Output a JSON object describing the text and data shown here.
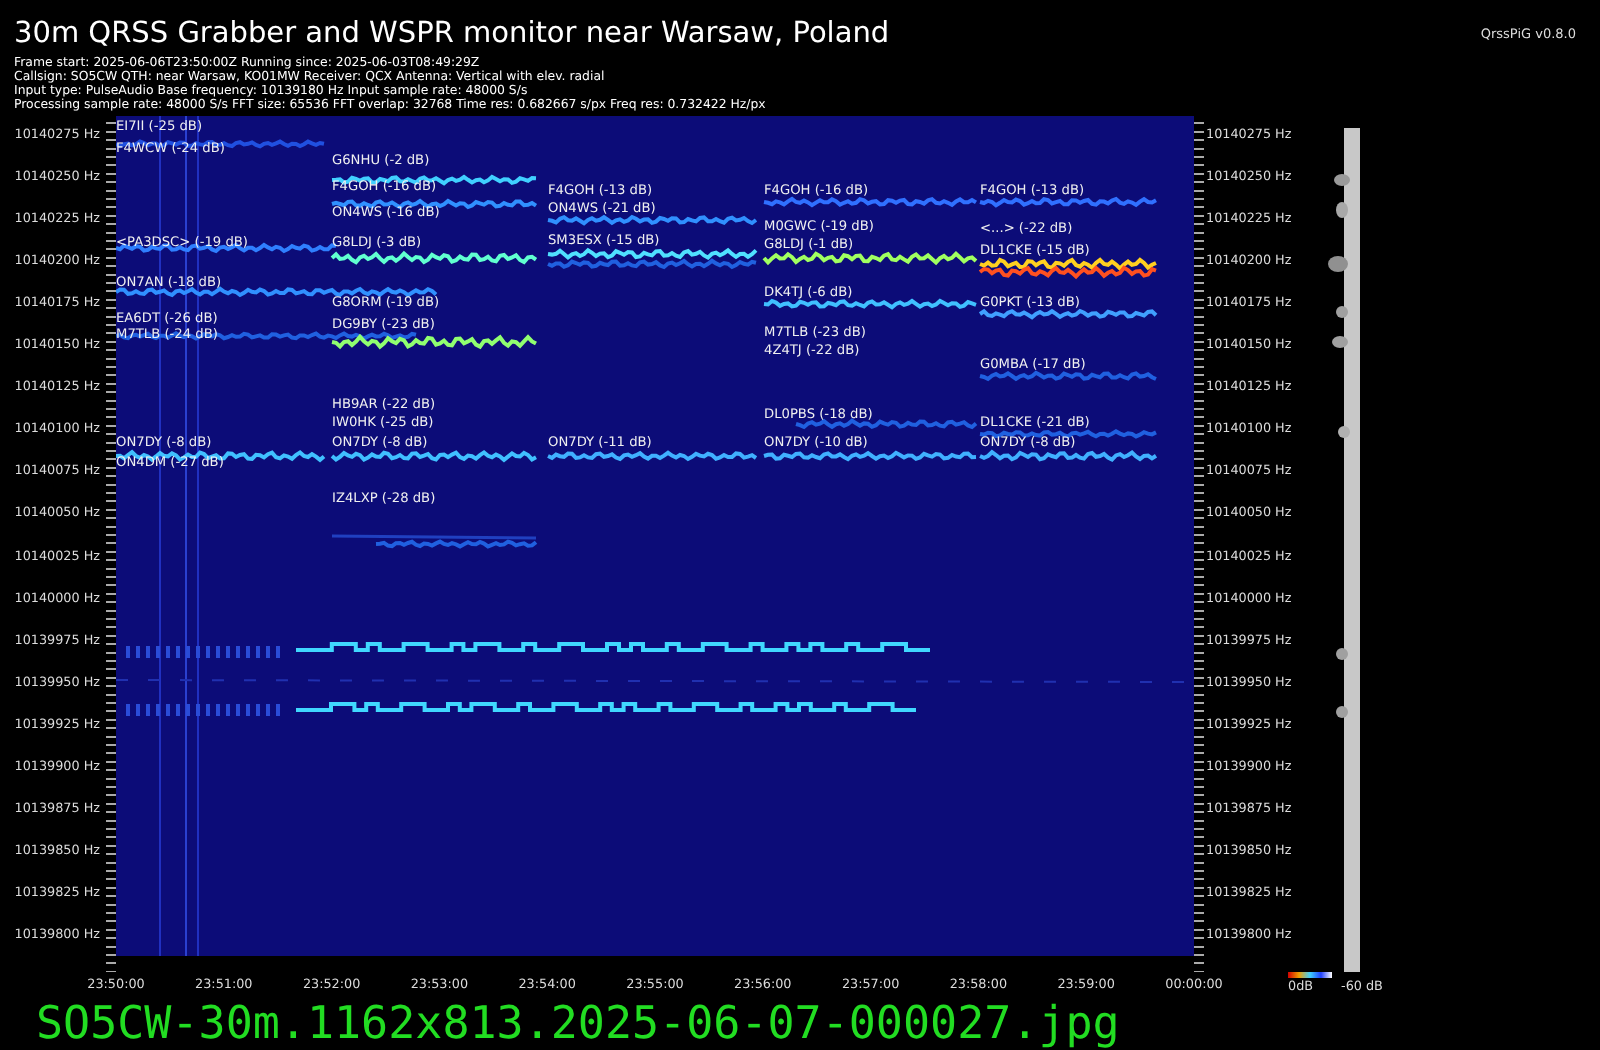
{
  "header": {
    "title": "30m QRSS Grabber and WSPR monitor near Warsaw, Poland",
    "version": "QrssPiG v0.8.0",
    "info_lines": [
      "Frame start: 2025-06-06T23:50:00Z Running since: 2025-06-03T08:49:29Z",
      "Callsign: SO5CW QTH: near Warsaw, KO01MW Receiver: QCX Antenna: Vertical with elev. radial",
      "Input type: PulseAudio Base frequency: 10139180 Hz Input sample rate: 48000 S/s",
      "Processing sample rate: 48000 S/s FFT size: 65536 FFT overlap: 32768 Time res: 0.682667 s/px Freq res: 0.732422 Hz/px"
    ]
  },
  "spectrogram": {
    "columns": [
      {
        "spots": [
          "EI7II (-25 dB)",
          "F4WCW (-24 dB)",
          "<PA3DSC> (-19 dB)",
          "ON7AN (-18 dB)",
          "EA6DT (-26 dB)",
          "M7TLB (-24 dB)",
          "ON7DY (-8 dB)",
          "ON4DM (-27 dB)"
        ]
      },
      {
        "spots": [
          "G6NHU (-2 dB)",
          "F4GOH (-16 dB)",
          "ON4WS (-16 dB)",
          "G8LDJ (-3 dB)",
          "G8ORM (-19 dB)",
          "DG9BY (-23 dB)",
          "HB9AR (-22 dB)",
          "IW0HK (-25 dB)",
          "ON7DY (-8 dB)",
          "IZ4LXP (-28 dB)"
        ]
      },
      {
        "spots": [
          "F4GOH (-13 dB)",
          "ON4WS (-21 dB)",
          "SM3ESX (-15 dB)",
          "ON7DY (-11 dB)"
        ]
      },
      {
        "spots": [
          "F4GOH (-16 dB)",
          "M0GWC (-19 dB)",
          "G8LDJ (-1 dB)",
          "DK4TJ (-6 dB)",
          "M7TLB (-23 dB)",
          "4Z4TJ (-22 dB)",
          "DL0PBS (-18 dB)",
          "ON7DY (-10 dB)"
        ]
      },
      {
        "spots": [
          "F4GOH (-13 dB)",
          "<...> (-22 dB)",
          "DL1CKE (-15 dB)",
          "G0PKT (-13 dB)",
          "G0MBA (-17 dB)",
          "DL1CKE (-21 dB)",
          "ON7DY (-8 dB)"
        ]
      }
    ]
  },
  "frequency_axis_left": [
    "10140275 Hz",
    "10140250 Hz",
    "10140225 Hz",
    "10140200 Hz",
    "10140175 Hz",
    "10140150 Hz",
    "10140125 Hz",
    "10140100 Hz",
    "10140075 Hz",
    "10140050 Hz",
    "10140025 Hz",
    "10140000 Hz",
    "10139975 Hz",
    "10139950 Hz",
    "10139925 Hz",
    "10139900 Hz",
    "10139875 Hz",
    "10139850 Hz",
    "10139825 Hz",
    "10139800 Hz"
  ],
  "frequency_axis_right": [
    "10140275 Hz",
    "10140250 Hz",
    "10140225 Hz",
    "10140200 Hz",
    "10140175 Hz",
    "10140150 Hz",
    "10140125 Hz",
    "10140100 Hz",
    "10140075 Hz",
    "10140050 Hz",
    "10140025 Hz",
    "10140000 Hz",
    "10139975 Hz",
    "10139950 Hz",
    "10139925 Hz",
    "10139900 Hz",
    "10139875 Hz",
    "10139850 Hz",
    "10139825 Hz",
    "10139800 Hz"
  ],
  "time_axis": [
    "23:50:00",
    "23:51:00",
    "23:52:00",
    "23:53:00",
    "23:54:00",
    "23:55:00",
    "23:56:00",
    "23:57:00",
    "23:58:00",
    "23:59:00",
    "00:00:00"
  ],
  "colorbar": {
    "min_label": "0dB",
    "max_label": "-60 dB"
  },
  "filename": "SO5CW-30m.1162x813.2025-06-07-000027.jpg"
}
